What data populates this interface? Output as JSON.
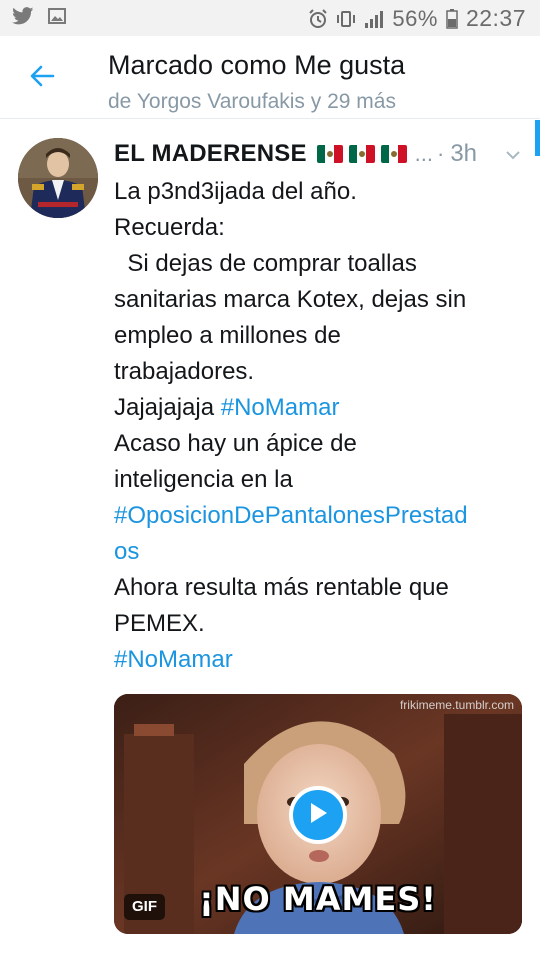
{
  "status_bar": {
    "battery_percent": "56%",
    "time": "22:37",
    "left_icons": [
      "twitter-icon",
      "image-icon"
    ],
    "right_icons": [
      "alarm-icon",
      "vibrate-icon",
      "signal-icon",
      "battery-icon"
    ]
  },
  "header": {
    "title": "Marcado como Me gusta",
    "subtitle": "de Yorgos Varoufakis y 29 más",
    "back_icon": "arrow-left-icon"
  },
  "tweet": {
    "author": "EL MADERENSE",
    "flags": [
      "mexico-flag",
      "mexico-flag",
      "mexico-flag"
    ],
    "ellipsis": "...",
    "separator": "·",
    "time": "3h",
    "lines": [
      {
        "text": "La p3nd3ijada del año.",
        "tag": ""
      },
      {
        "text": "Recuerda:",
        "tag": ""
      },
      {
        "text": "  Si dejas de comprar toallas",
        "tag": ""
      },
      {
        "text": "sanitarias marca Kotex, dejas sin",
        "tag": ""
      },
      {
        "text": "empleo a millones de",
        "tag": ""
      },
      {
        "text": "trabajadores.",
        "tag": ""
      },
      {
        "text": "Jajajajaja ",
        "tag": "#NoMamar"
      },
      {
        "text": "Acaso hay un ápice de",
        "tag": ""
      },
      {
        "text": "inteligencia en la",
        "tag": ""
      },
      {
        "text": "",
        "tag": "#OposicionDePantalonesPrestad"
      },
      {
        "text": "",
        "tag": "os"
      },
      {
        "text": "Ahora resulta más rentable que",
        "tag": ""
      },
      {
        "text": "PEMEX.",
        "tag": ""
      },
      {
        "text": "",
        "tag": "#NoMamar"
      }
    ],
    "media": {
      "watermark": "frikimeme.tumblr.com",
      "caption": "¡NO MAMES!",
      "badge": "GIF",
      "play_icon": "play-icon"
    }
  },
  "colors": {
    "accent": "#1da1f2",
    "hashtag": "#1b95e0",
    "secondary_text": "#8899a6",
    "primary_text": "#14171a"
  }
}
